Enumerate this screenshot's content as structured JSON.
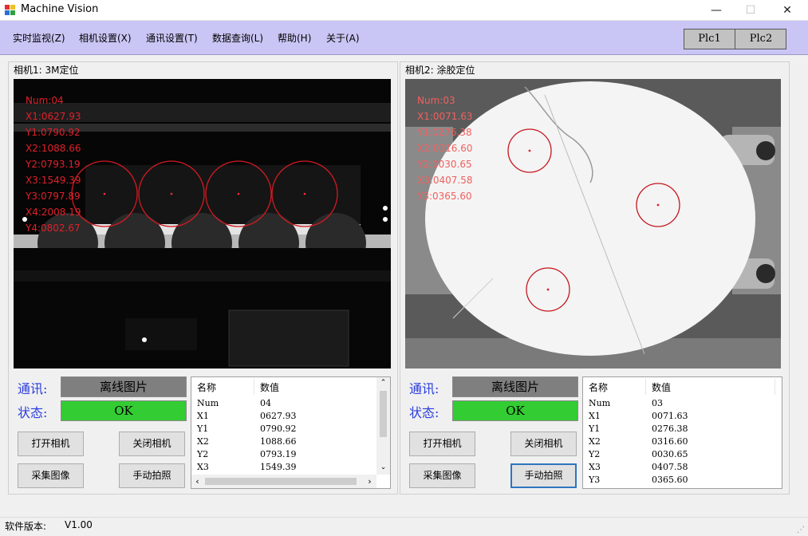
{
  "window": {
    "title": "Machine Vision",
    "minimize": "—",
    "maximize": "☐",
    "close": "✕"
  },
  "menu": {
    "items": [
      "实时监视(Z)",
      "相机设置(X)",
      "通讯设置(T)",
      "数据查询(L)",
      "帮助(H)",
      "关于(A)"
    ],
    "plc1": "Plc1",
    "plc2": "Plc2"
  },
  "camera1": {
    "title": "相机1:  3M定位",
    "overlay": [
      "Num:04",
      "X1:0627.93",
      "Y1:0790.92",
      "X2:1088.66",
      "Y2:0793.19",
      "X3:1549.39",
      "Y3:0797.89",
      "X4:2008.19",
      "Y4:0802.67"
    ],
    "comm_label": "通讯:",
    "comm_value": "离线图片",
    "status_label": "状态:",
    "status_value": "OK",
    "open_camera": "打开相机",
    "close_camera": "关闭相机",
    "capture": "采集图像",
    "manual_shot": "手动拍照",
    "table": {
      "headers": [
        "名称",
        "数值"
      ],
      "rows": [
        [
          "Num",
          "04"
        ],
        [
          "X1",
          "0627.93"
        ],
        [
          "Y1",
          "0790.92"
        ],
        [
          "X2",
          "1088.66"
        ],
        [
          "Y2",
          "0793.19"
        ],
        [
          "X3",
          "1549.39"
        ]
      ]
    }
  },
  "camera2": {
    "title": "相机2:  涂胶定位",
    "overlay": [
      "Num:03",
      "X1:0071.63",
      "Y1:0276.38",
      "X2:0316.60",
      "Y2:0030.65",
      "X3:0407.58",
      "Y3:0365.60"
    ],
    "comm_label": "通讯:",
    "comm_value": "离线图片",
    "status_label": "状态:",
    "status_value": "OK",
    "open_camera": "打开相机",
    "close_camera": "关闭相机",
    "capture": "采集图像",
    "manual_shot": "手动拍照",
    "table": {
      "headers": [
        "名称",
        "数值"
      ],
      "rows": [
        [
          "Num",
          "03"
        ],
        [
          "X1",
          "0071.63"
        ],
        [
          "Y1",
          "0276.38"
        ],
        [
          "X2",
          "0316.60"
        ],
        [
          "Y2",
          "0030.65"
        ],
        [
          "X3",
          "0407.58"
        ],
        [
          "Y3",
          "0365.60"
        ]
      ]
    }
  },
  "statusbar": {
    "version_label": "软件版本:",
    "version_value": "V1.00"
  },
  "colors": {
    "menu_bg": "#c9c6f5",
    "status_ok": "#33cc33",
    "comm_bg": "#7f7f7f",
    "overlay_red": "#e0202a",
    "label_blue": "#2a3de0"
  }
}
